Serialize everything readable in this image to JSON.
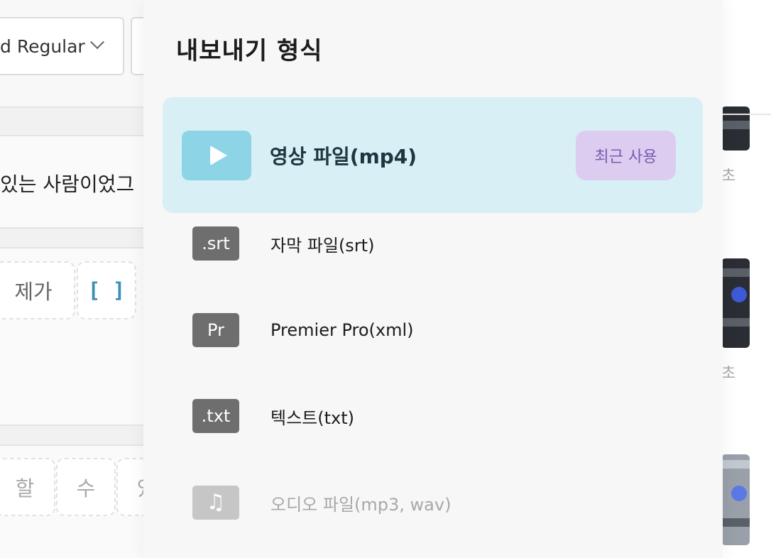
{
  "background": {
    "font_select_value": "d Regular",
    "sentence_text": "있는 사람이었그",
    "chips_row1": [
      "제가",
      "[ ]"
    ],
    "chips_row2": [
      "할",
      "수",
      "있"
    ],
    "right_units": [
      "초",
      "초"
    ]
  },
  "dialog": {
    "title": "내보내기 형식",
    "options": [
      {
        "icon": "play-icon",
        "label": "영상 파일(mp4)",
        "badge": "최근 사용",
        "selected": true
      },
      {
        "icon_text": ".srt",
        "label": "자막 파일(srt)"
      },
      {
        "icon_text": "Pr",
        "label": "Premier Pro(xml)"
      },
      {
        "icon_text": ".txt",
        "label": "텍스트(txt)"
      },
      {
        "icon": "music-note-icon",
        "label": "오디오 파일(mp3, wav)",
        "disabled": true
      }
    ]
  },
  "colors": {
    "selected_bg": "#d7eff5",
    "play_box": "#8dd5e6",
    "badge_bg": "#dccdf0",
    "badge_text": "#7a5bb0",
    "format_icon": "#6e6e6e"
  }
}
